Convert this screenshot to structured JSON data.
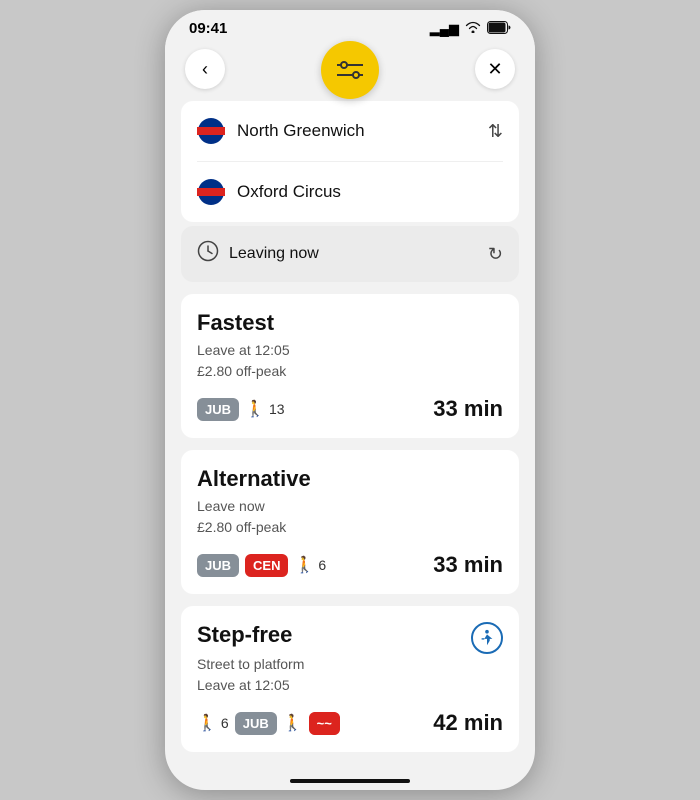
{
  "status": {
    "time": "09:41",
    "signal": "▂▄▆",
    "wifi": "wifi",
    "battery": "battery"
  },
  "nav": {
    "back_label": "‹",
    "close_label": "✕",
    "filter_icon": "⇄"
  },
  "stations": {
    "from": "North Greenwich",
    "to": "Oxford Circus",
    "swap_icon": "⇅"
  },
  "time_selector": {
    "label": "Leaving now",
    "refresh_icon": "↻"
  },
  "journeys": [
    {
      "title": "Fastest",
      "line1": "Leave at 12:05",
      "line2": "£2.80 off-peak",
      "tags": [
        "JUB"
      ],
      "walk": "13",
      "duration": "33 min"
    },
    {
      "title": "Alternative",
      "line1": "Leave now",
      "line2": "£2.80 off-peak",
      "tags": [
        "JUB",
        "CEN"
      ],
      "walk": "6",
      "duration": "33 min"
    },
    {
      "title": "Step-free",
      "line1": "Street to platform",
      "line2": "Leave at 12:05",
      "tags": [
        "JUB"
      ],
      "walk_prefix": "6",
      "duration": "42 min",
      "accessible": true
    }
  ],
  "colors": {
    "yellow": "#f5c800",
    "jubilee": "#868f98",
    "central": "#dc241f"
  }
}
